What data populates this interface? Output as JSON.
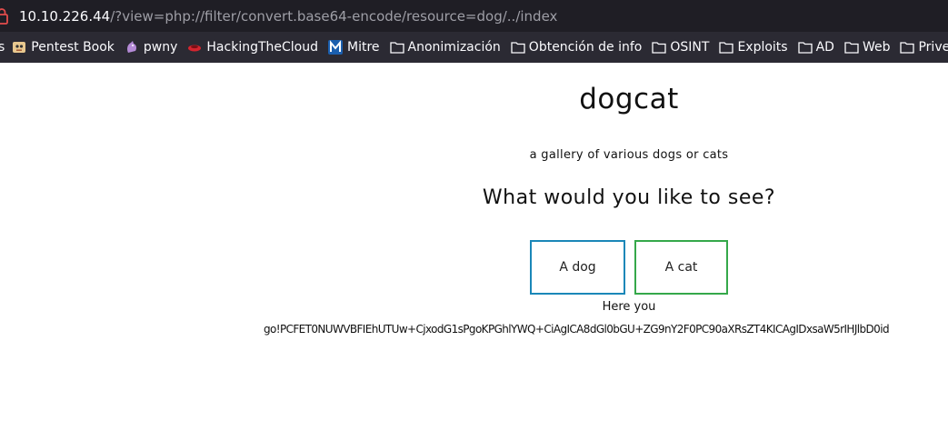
{
  "browser": {
    "url_host": "10.10.226.44",
    "url_rest": "/?view=php://filter/convert.base64-encode/resource=dog/../index",
    "bookmarks": [
      {
        "label": "s",
        "icon": "partial-icon"
      },
      {
        "label": "Pentest Book",
        "icon": "pentest-book-icon"
      },
      {
        "label": "pwny",
        "icon": "pwny-icon"
      },
      {
        "label": "HackingTheCloud",
        "icon": "hackingthecloud-icon"
      },
      {
        "label": "Mitre",
        "icon": "mitre-icon"
      },
      {
        "label": "Anonimización",
        "icon": "folder-icon"
      },
      {
        "label": "Obtención de info",
        "icon": "folder-icon"
      },
      {
        "label": "OSINT",
        "icon": "folder-icon"
      },
      {
        "label": "Exploits",
        "icon": "folder-icon"
      },
      {
        "label": "AD",
        "icon": "folder-icon"
      },
      {
        "label": "Web",
        "icon": "folder-icon"
      },
      {
        "label": "Privesc",
        "icon": "folder-icon"
      }
    ]
  },
  "page": {
    "title": "dogcat",
    "subtitle": "a gallery of various dogs or cats",
    "question": "What would you like to see?",
    "buttons": {
      "dog": "A dog",
      "cat": "A cat"
    },
    "here_you": "Here you",
    "output": "go!PCFET0NUWVBFIEhUTUw+CjxodG1sPgoKPGhlYWQ+CiAgICA8dGl0bGU+ZG9nY2F0PC90aXRsZT4KICAgIDxsaW5rIHJlbD0id"
  },
  "colors": {
    "urlbar_bg": "#1f1e25",
    "bookmarks_bg": "#2b2a33",
    "dog_border": "#1a87b8",
    "cat_border": "#35a84a"
  }
}
